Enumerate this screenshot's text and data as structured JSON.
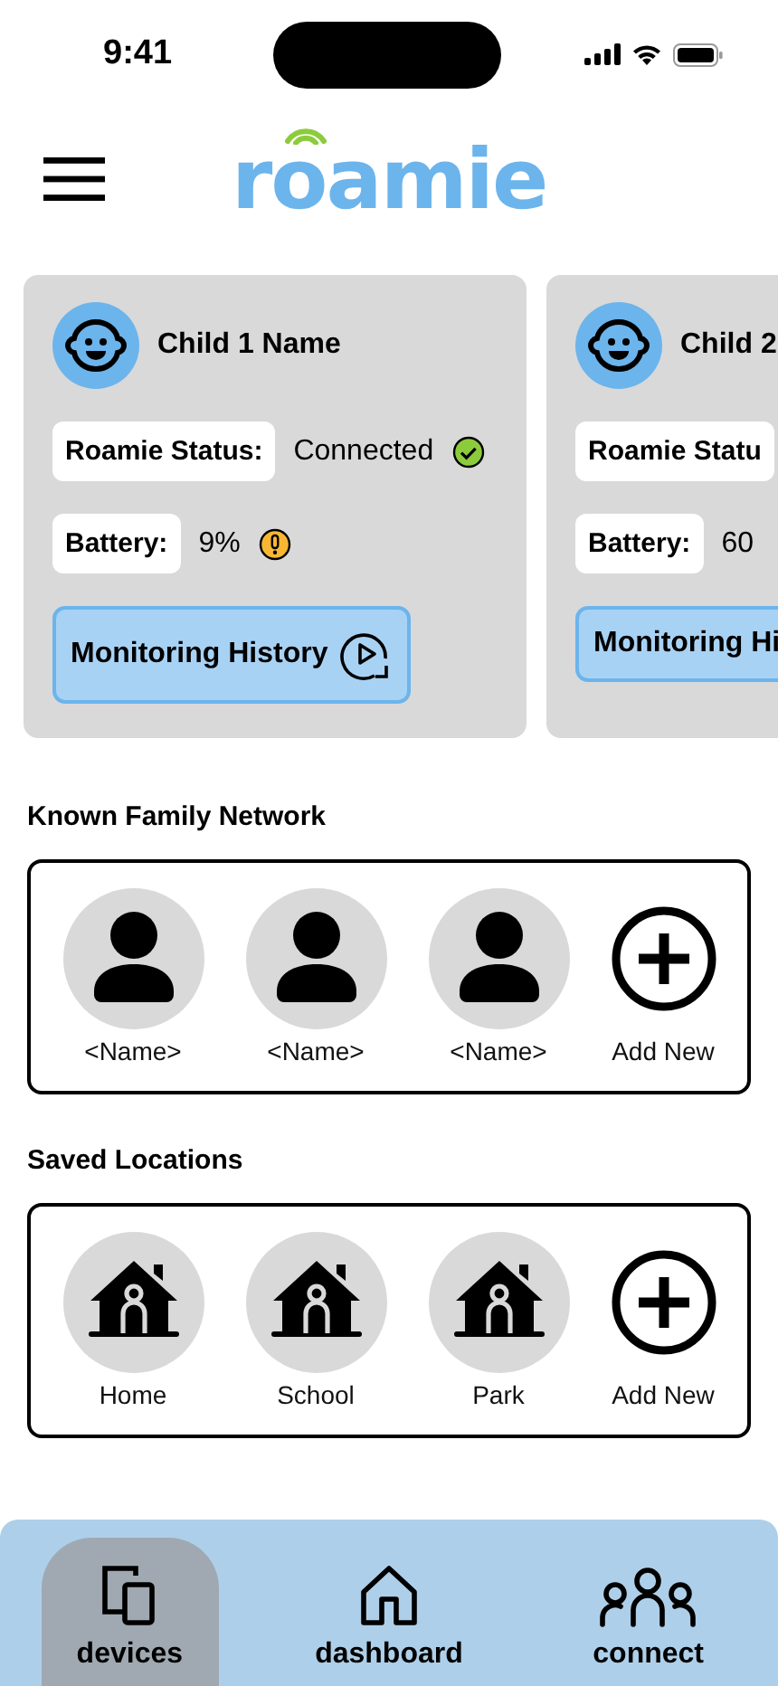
{
  "status_bar": {
    "time": "9:41"
  },
  "header": {
    "logo": "roamie"
  },
  "children": [
    {
      "name": "Child 1 Name",
      "status_label": "Roamie Status:",
      "status": "Connected",
      "status_ok": true,
      "battery_label": "Battery:",
      "battery": "9%",
      "battery_low": true,
      "history_button": "Monitoring History"
    },
    {
      "name": "Child 2",
      "status_label": "Roamie Statu",
      "battery_label": "Battery:",
      "battery": "60",
      "history_button": "Monitoring Hi"
    }
  ],
  "family": {
    "title": "Known Family Network",
    "items": [
      {
        "kind": "person",
        "label": "<Name>"
      },
      {
        "kind": "person",
        "label": "<Name>"
      },
      {
        "kind": "person",
        "label": "<Name>"
      },
      {
        "kind": "add",
        "label": "Add New"
      }
    ]
  },
  "locations": {
    "title": "Saved Locations",
    "items": [
      {
        "kind": "place",
        "label": "Home"
      },
      {
        "kind": "place",
        "label": "School"
      },
      {
        "kind": "place",
        "label": "Park"
      },
      {
        "kind": "add",
        "label": "Add New"
      }
    ]
  },
  "nav": [
    {
      "kind": "devices",
      "label": "devices",
      "selected": true
    },
    {
      "kind": "dashboard",
      "label": "dashboard",
      "selected": false
    },
    {
      "kind": "connect",
      "label": "connect",
      "selected": false
    }
  ]
}
